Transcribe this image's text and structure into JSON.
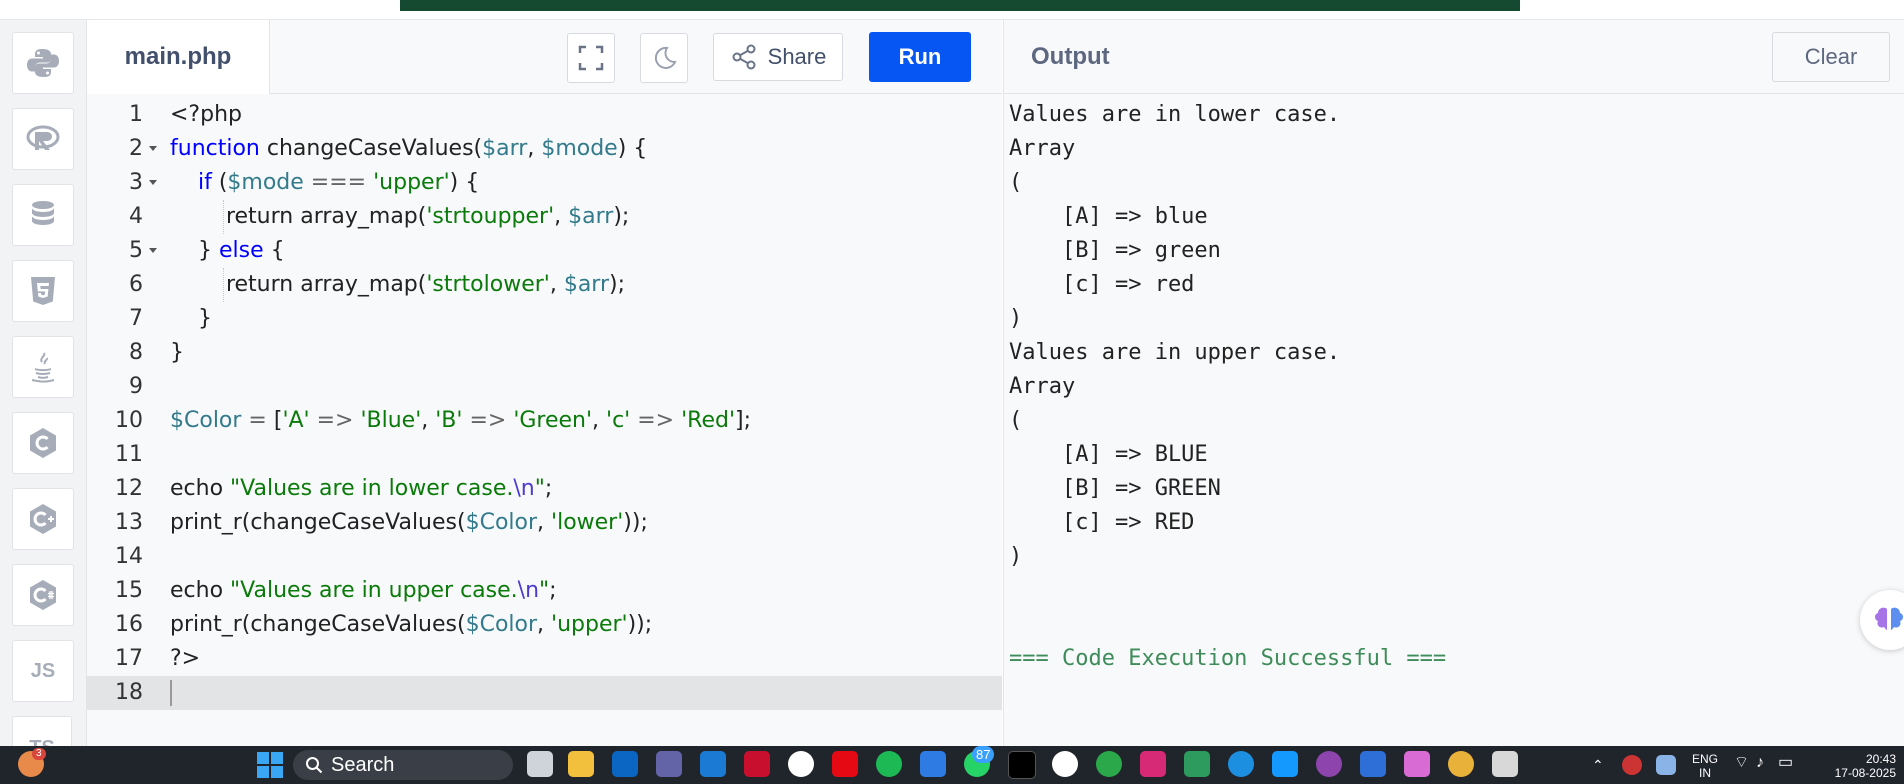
{
  "editor": {
    "file_tab": "main.php",
    "share_label": "Share",
    "run_label": "Run",
    "active_line": 18,
    "lines": [
      {
        "n": "1",
        "fold": false,
        "indent": 0,
        "tokens": [
          {
            "t": "<?php",
            "c": ""
          }
        ]
      },
      {
        "n": "2",
        "fold": true,
        "indent": 0,
        "tokens": [
          {
            "t": "function",
            "c": "kw"
          },
          {
            "t": " changeCaseValues(",
            "c": ""
          },
          {
            "t": "$arr",
            "c": "var"
          },
          {
            "t": ", ",
            "c": ""
          },
          {
            "t": "$mode",
            "c": "var"
          },
          {
            "t": ") {",
            "c": ""
          }
        ]
      },
      {
        "n": "3",
        "fold": true,
        "indent": 1,
        "tokens": [
          {
            "t": "    ",
            "c": ""
          },
          {
            "t": "if",
            "c": "kw"
          },
          {
            "t": " (",
            "c": ""
          },
          {
            "t": "$mode",
            "c": "var"
          },
          {
            "t": " === ",
            "c": "op"
          },
          {
            "t": "'upper'",
            "c": "str"
          },
          {
            "t": ") {",
            "c": ""
          }
        ]
      },
      {
        "n": "4",
        "fold": false,
        "indent": 2,
        "tokens": [
          {
            "t": "        return array_map(",
            "c": ""
          },
          {
            "t": "'strtoupper'",
            "c": "str"
          },
          {
            "t": ", ",
            "c": ""
          },
          {
            "t": "$arr",
            "c": "var"
          },
          {
            "t": ");",
            "c": ""
          }
        ]
      },
      {
        "n": "5",
        "fold": true,
        "indent": 1,
        "tokens": [
          {
            "t": "    } ",
            "c": ""
          },
          {
            "t": "else",
            "c": "kw"
          },
          {
            "t": " {",
            "c": ""
          }
        ]
      },
      {
        "n": "6",
        "fold": false,
        "indent": 2,
        "tokens": [
          {
            "t": "        return array_map(",
            "c": ""
          },
          {
            "t": "'strtolower'",
            "c": "str"
          },
          {
            "t": ", ",
            "c": ""
          },
          {
            "t": "$arr",
            "c": "var"
          },
          {
            "t": ");",
            "c": ""
          }
        ]
      },
      {
        "n": "7",
        "fold": false,
        "indent": 1,
        "tokens": [
          {
            "t": "    }",
            "c": ""
          }
        ]
      },
      {
        "n": "8",
        "fold": false,
        "indent": 0,
        "tokens": [
          {
            "t": "}",
            "c": ""
          }
        ]
      },
      {
        "n": "9",
        "fold": false,
        "indent": 0,
        "tokens": []
      },
      {
        "n": "10",
        "fold": false,
        "indent": 0,
        "tokens": [
          {
            "t": "$Color",
            "c": "var"
          },
          {
            "t": " = ",
            "c": "op"
          },
          {
            "t": "[",
            "c": ""
          },
          {
            "t": "'A'",
            "c": "str"
          },
          {
            "t": " => ",
            "c": "op"
          },
          {
            "t": "'Blue'",
            "c": "str"
          },
          {
            "t": ", ",
            "c": ""
          },
          {
            "t": "'B'",
            "c": "str"
          },
          {
            "t": " => ",
            "c": "op"
          },
          {
            "t": "'Green'",
            "c": "str"
          },
          {
            "t": ", ",
            "c": ""
          },
          {
            "t": "'c'",
            "c": "str"
          },
          {
            "t": " => ",
            "c": "op"
          },
          {
            "t": "'Red'",
            "c": "str"
          },
          {
            "t": "];",
            "c": ""
          }
        ]
      },
      {
        "n": "11",
        "fold": false,
        "indent": 0,
        "tokens": []
      },
      {
        "n": "12",
        "fold": false,
        "indent": 0,
        "tokens": [
          {
            "t": "echo ",
            "c": ""
          },
          {
            "t": "\"Values are in lower case.",
            "c": "str"
          },
          {
            "t": "\\n",
            "c": "esc"
          },
          {
            "t": "\"",
            "c": "str"
          },
          {
            "t": ";",
            "c": ""
          }
        ]
      },
      {
        "n": "13",
        "fold": false,
        "indent": 0,
        "tokens": [
          {
            "t": "print_r(changeCaseValues(",
            "c": ""
          },
          {
            "t": "$Color",
            "c": "var"
          },
          {
            "t": ", ",
            "c": ""
          },
          {
            "t": "'lower'",
            "c": "str"
          },
          {
            "t": "));",
            "c": ""
          }
        ]
      },
      {
        "n": "14",
        "fold": false,
        "indent": 0,
        "tokens": []
      },
      {
        "n": "15",
        "fold": false,
        "indent": 0,
        "tokens": [
          {
            "t": "echo ",
            "c": ""
          },
          {
            "t": "\"Values are in upper case.",
            "c": "str"
          },
          {
            "t": "\\n",
            "c": "esc"
          },
          {
            "t": "\"",
            "c": "str"
          },
          {
            "t": ";",
            "c": ""
          }
        ]
      },
      {
        "n": "16",
        "fold": false,
        "indent": 0,
        "tokens": [
          {
            "t": "print_r(changeCaseValues(",
            "c": ""
          },
          {
            "t": "$Color",
            "c": "var"
          },
          {
            "t": ", ",
            "c": ""
          },
          {
            "t": "'upper'",
            "c": "str"
          },
          {
            "t": "));",
            "c": ""
          }
        ]
      },
      {
        "n": "17",
        "fold": false,
        "indent": 0,
        "tokens": [
          {
            "t": "?>",
            "c": ""
          }
        ]
      },
      {
        "n": "18",
        "fold": false,
        "indent": 0,
        "tokens": []
      }
    ]
  },
  "output": {
    "title": "Output",
    "clear_label": "Clear",
    "lines": [
      "Values are in lower case.",
      "Array",
      "(",
      "    [A] => blue",
      "    [B] => green",
      "    [c] => red",
      ")",
      "Values are in upper case.",
      "Array",
      "(",
      "    [A] => BLUE",
      "    [B] => GREEN",
      "    [c] => RED",
      ")",
      "",
      "",
      "=== Code Execution Successful ==="
    ]
  },
  "sidebar": {
    "icons": [
      "python-icon",
      "r-icon",
      "database-icon",
      "html5-icon",
      "java-icon",
      "c-icon",
      "cpp-icon",
      "csharp-icon",
      "js-icon",
      "ts-icon"
    ],
    "js_label": "JS",
    "ts_label": "TS"
  },
  "taskbar": {
    "search_label": "Search",
    "weather_badge": "3",
    "whatsapp_badge": "87",
    "lang_line1": "ENG",
    "lang_line2": "IN",
    "time": "20:43",
    "date": "17-08-2025"
  }
}
